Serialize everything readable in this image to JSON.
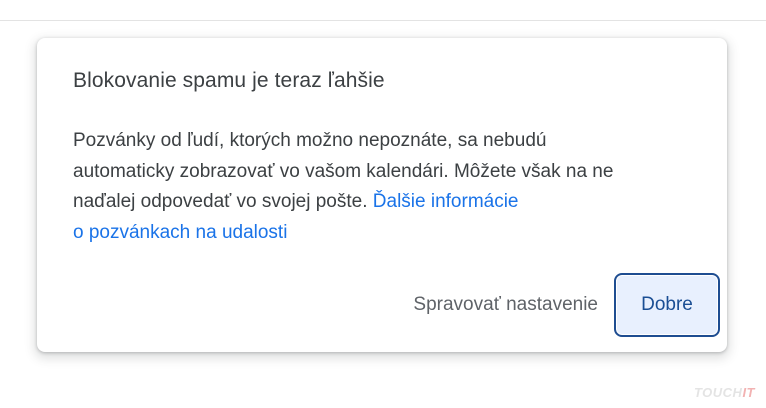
{
  "dialog": {
    "title": "Blokovanie spamu je teraz ľahšie",
    "body_lines": [
      "Pozvánky od ľudí, ktorých možno nepoznáte, sa nebudú",
      "automaticky zobrazovať vo vašom kalendári. Môžete však na ne",
      "naďalej odpovedať vo svojej pošte. "
    ],
    "link_line_1": "Ďalšie informácie",
    "link_line_2": "o pozvánkach na udalosti",
    "secondary_button": "Spravovať nastavenie",
    "primary_button": "Dobre"
  },
  "watermark": {
    "main": "TOUCH",
    "accent": "IT"
  },
  "colors": {
    "link": "#1a73e8",
    "primary_button_bg": "#e8f0fe",
    "primary_button_border": "#1e4d91",
    "text": "#3c4043"
  }
}
